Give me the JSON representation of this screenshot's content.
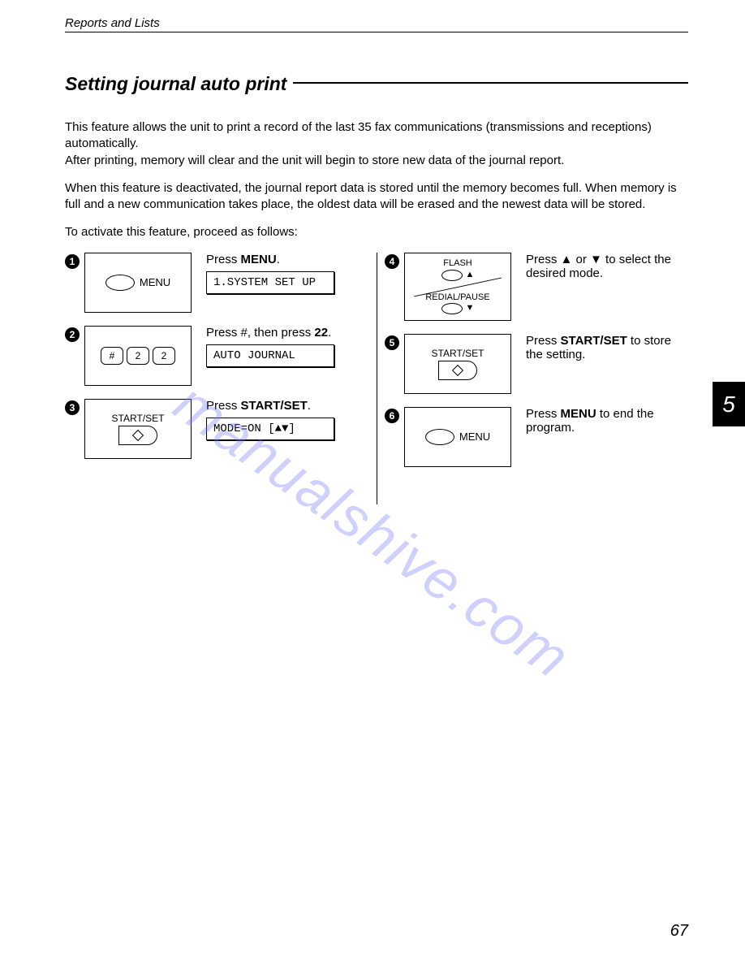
{
  "header": "Reports and Lists",
  "title": "Setting journal auto print",
  "para1": "This feature allows the unit to print a record of the last 35 fax communications (transmissions and receptions) automatically.",
  "para2": "After printing, memory will clear and the unit will begin to store new data of the journal report.",
  "para3": "When this feature is deactivated, the journal report data is stored until the memory becomes full. When memory is full and a new communication takes place, the oldest data will be erased and the newest data will be stored.",
  "para4": "To activate this feature, proceed as follows:",
  "steps": {
    "s1": {
      "num": "1",
      "btn_label": "MENU",
      "instr_pre": "Press ",
      "instr_b": "MENU",
      "instr_post": ".",
      "display": "1.SYSTEM SET UP"
    },
    "s2": {
      "num": "2",
      "keys": [
        "#",
        "2",
        "2"
      ],
      "instr_pre": "Press #, then press ",
      "instr_b": "22",
      "instr_post": ".",
      "display": "AUTO JOURNAL"
    },
    "s3": {
      "num": "3",
      "btn_label": "START/SET",
      "instr_pre": "Press ",
      "instr_b": "START/SET",
      "instr_post": ".",
      "display": "MODE=ON    [▲▼]"
    },
    "s4": {
      "num": "4",
      "flash": "FLASH",
      "redial": "REDIAL/PAUSE",
      "instr": "Press ▲ or ▼ to select the desired mode."
    },
    "s5": {
      "num": "5",
      "btn_label": "START/SET",
      "instr_pre": "Press ",
      "instr_b": "START/SET",
      "instr_post": " to store the setting."
    },
    "s6": {
      "num": "6",
      "btn_label": "MENU",
      "instr_pre": "Press ",
      "instr_b": "MENU",
      "instr_post": " to end the program."
    }
  },
  "side_tab": "5",
  "page_number": "67",
  "watermark": "manualshive.com"
}
